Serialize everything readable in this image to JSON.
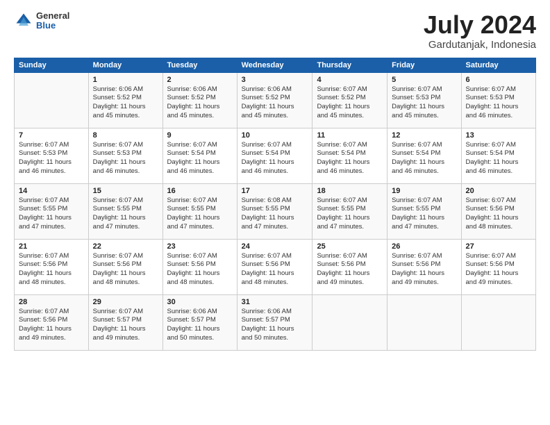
{
  "logo": {
    "general": "General",
    "blue": "Blue"
  },
  "title": "July 2024",
  "subtitle": "Gardutanjak, Indonesia",
  "days_header": [
    "Sunday",
    "Monday",
    "Tuesday",
    "Wednesday",
    "Thursday",
    "Friday",
    "Saturday"
  ],
  "weeks": [
    [
      {
        "day": "",
        "info": ""
      },
      {
        "day": "1",
        "info": "Sunrise: 6:06 AM\nSunset: 5:52 PM\nDaylight: 11 hours\nand 45 minutes."
      },
      {
        "day": "2",
        "info": "Sunrise: 6:06 AM\nSunset: 5:52 PM\nDaylight: 11 hours\nand 45 minutes."
      },
      {
        "day": "3",
        "info": "Sunrise: 6:06 AM\nSunset: 5:52 PM\nDaylight: 11 hours\nand 45 minutes."
      },
      {
        "day": "4",
        "info": "Sunrise: 6:07 AM\nSunset: 5:52 PM\nDaylight: 11 hours\nand 45 minutes."
      },
      {
        "day": "5",
        "info": "Sunrise: 6:07 AM\nSunset: 5:53 PM\nDaylight: 11 hours\nand 45 minutes."
      },
      {
        "day": "6",
        "info": "Sunrise: 6:07 AM\nSunset: 5:53 PM\nDaylight: 11 hours\nand 46 minutes."
      }
    ],
    [
      {
        "day": "7",
        "info": "Sunrise: 6:07 AM\nSunset: 5:53 PM\nDaylight: 11 hours\nand 46 minutes."
      },
      {
        "day": "8",
        "info": "Sunrise: 6:07 AM\nSunset: 5:53 PM\nDaylight: 11 hours\nand 46 minutes."
      },
      {
        "day": "9",
        "info": "Sunrise: 6:07 AM\nSunset: 5:54 PM\nDaylight: 11 hours\nand 46 minutes."
      },
      {
        "day": "10",
        "info": "Sunrise: 6:07 AM\nSunset: 5:54 PM\nDaylight: 11 hours\nand 46 minutes."
      },
      {
        "day": "11",
        "info": "Sunrise: 6:07 AM\nSunset: 5:54 PM\nDaylight: 11 hours\nand 46 minutes."
      },
      {
        "day": "12",
        "info": "Sunrise: 6:07 AM\nSunset: 5:54 PM\nDaylight: 11 hours\nand 46 minutes."
      },
      {
        "day": "13",
        "info": "Sunrise: 6:07 AM\nSunset: 5:54 PM\nDaylight: 11 hours\nand 46 minutes."
      }
    ],
    [
      {
        "day": "14",
        "info": "Sunrise: 6:07 AM\nSunset: 5:55 PM\nDaylight: 11 hours\nand 47 minutes."
      },
      {
        "day": "15",
        "info": "Sunrise: 6:07 AM\nSunset: 5:55 PM\nDaylight: 11 hours\nand 47 minutes."
      },
      {
        "day": "16",
        "info": "Sunrise: 6:07 AM\nSunset: 5:55 PM\nDaylight: 11 hours\nand 47 minutes."
      },
      {
        "day": "17",
        "info": "Sunrise: 6:08 AM\nSunset: 5:55 PM\nDaylight: 11 hours\nand 47 minutes."
      },
      {
        "day": "18",
        "info": "Sunrise: 6:07 AM\nSunset: 5:55 PM\nDaylight: 11 hours\nand 47 minutes."
      },
      {
        "day": "19",
        "info": "Sunrise: 6:07 AM\nSunset: 5:55 PM\nDaylight: 11 hours\nand 47 minutes."
      },
      {
        "day": "20",
        "info": "Sunrise: 6:07 AM\nSunset: 5:56 PM\nDaylight: 11 hours\nand 48 minutes."
      }
    ],
    [
      {
        "day": "21",
        "info": "Sunrise: 6:07 AM\nSunset: 5:56 PM\nDaylight: 11 hours\nand 48 minutes."
      },
      {
        "day": "22",
        "info": "Sunrise: 6:07 AM\nSunset: 5:56 PM\nDaylight: 11 hours\nand 48 minutes."
      },
      {
        "day": "23",
        "info": "Sunrise: 6:07 AM\nSunset: 5:56 PM\nDaylight: 11 hours\nand 48 minutes."
      },
      {
        "day": "24",
        "info": "Sunrise: 6:07 AM\nSunset: 5:56 PM\nDaylight: 11 hours\nand 48 minutes."
      },
      {
        "day": "25",
        "info": "Sunrise: 6:07 AM\nSunset: 5:56 PM\nDaylight: 11 hours\nand 49 minutes."
      },
      {
        "day": "26",
        "info": "Sunrise: 6:07 AM\nSunset: 5:56 PM\nDaylight: 11 hours\nand 49 minutes."
      },
      {
        "day": "27",
        "info": "Sunrise: 6:07 AM\nSunset: 5:56 PM\nDaylight: 11 hours\nand 49 minutes."
      }
    ],
    [
      {
        "day": "28",
        "info": "Sunrise: 6:07 AM\nSunset: 5:56 PM\nDaylight: 11 hours\nand 49 minutes."
      },
      {
        "day": "29",
        "info": "Sunrise: 6:07 AM\nSunset: 5:57 PM\nDaylight: 11 hours\nand 49 minutes."
      },
      {
        "day": "30",
        "info": "Sunrise: 6:06 AM\nSunset: 5:57 PM\nDaylight: 11 hours\nand 50 minutes."
      },
      {
        "day": "31",
        "info": "Sunrise: 6:06 AM\nSunset: 5:57 PM\nDaylight: 11 hours\nand 50 minutes."
      },
      {
        "day": "",
        "info": ""
      },
      {
        "day": "",
        "info": ""
      },
      {
        "day": "",
        "info": ""
      }
    ]
  ]
}
